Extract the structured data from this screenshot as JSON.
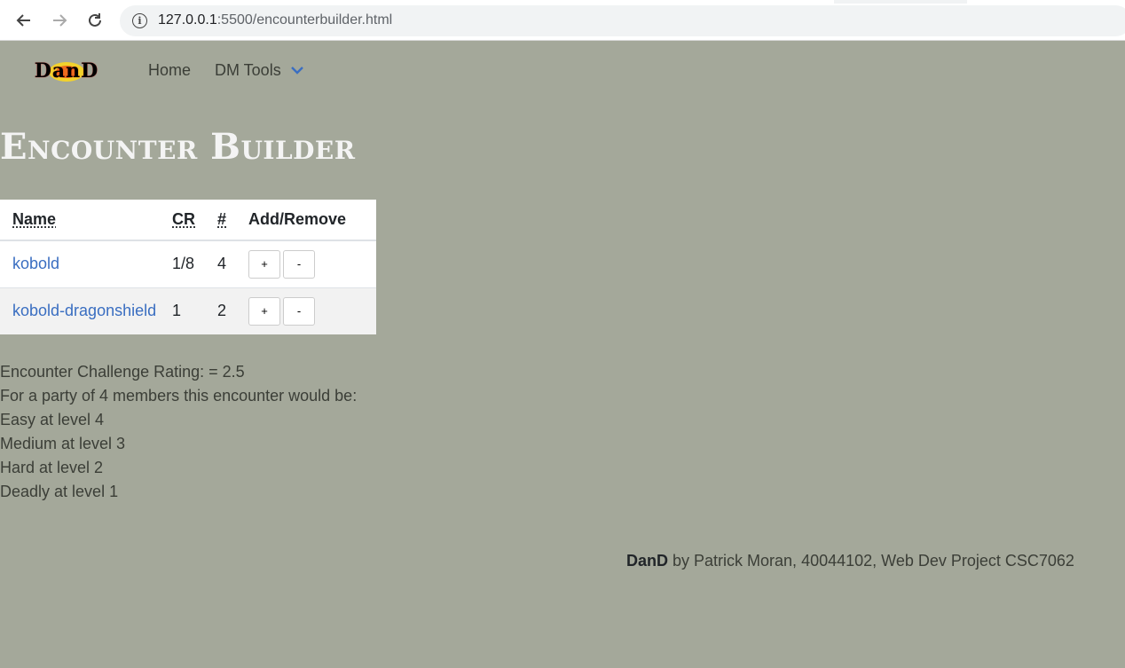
{
  "browser": {
    "url_host": "127.0.0.1",
    "url_rest": ":5500/encounterbuilder.html",
    "icons": [
      "back-arrow-icon",
      "forward-arrow-icon",
      "reload-icon",
      "info-icon"
    ]
  },
  "nav": {
    "logo_text": "DanD",
    "home": "Home",
    "dm_tools": "DM Tools"
  },
  "page": {
    "title": "Encounter Builder"
  },
  "table": {
    "headers": {
      "name": "Name",
      "cr": "CR",
      "count": "#",
      "add_remove": "Add/Remove"
    },
    "rows": [
      {
        "name": "kobold",
        "cr": "1/8",
        "count": "4",
        "plus": "+",
        "minus": "-"
      },
      {
        "name": "kobold-dragonshield",
        "cr": "1",
        "count": "2",
        "plus": "+",
        "minus": "-"
      }
    ]
  },
  "results": {
    "challenge_rating": "Encounter Challenge Rating: = 2.5",
    "party_line": "For a party of 4 members this encounter would be:",
    "easy": "Easy at level 4",
    "medium": "Medium at level 3",
    "hard": "Hard at level 2",
    "deadly": "Deadly at level 1"
  },
  "footer": {
    "brand": "DanD",
    "text": " by Patrick Moran, 40044102, Web Dev Project CSC7062"
  },
  "colors": {
    "page_background": "#a4a89a",
    "link": "#3a6ec1",
    "title": "#f4f4f4",
    "chevron": "#3a6ec1"
  }
}
